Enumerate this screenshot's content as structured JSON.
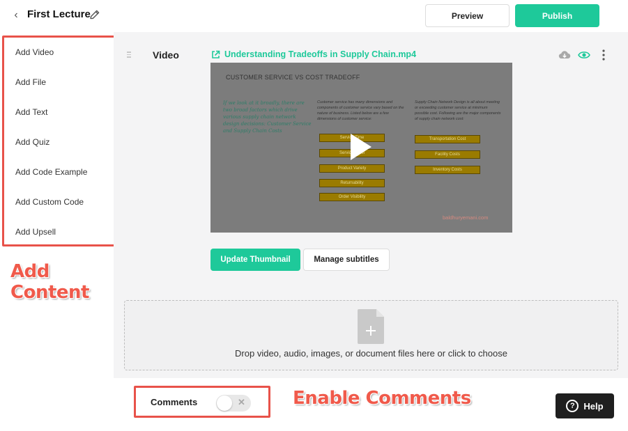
{
  "header": {
    "title": "First Lecture",
    "preview_label": "Preview",
    "publish_label": "Publish"
  },
  "sidebar": {
    "items": [
      {
        "label": "Add Video"
      },
      {
        "label": "Add File"
      },
      {
        "label": "Add Text"
      },
      {
        "label": "Add Quiz"
      },
      {
        "label": "Add Code Example"
      },
      {
        "label": "Add Custom Code"
      },
      {
        "label": "Add Upsell"
      }
    ]
  },
  "annotations": {
    "add_content": "Add Content",
    "enable_comments": "Enable Comments"
  },
  "lesson": {
    "section_label": "Video",
    "file_name": "Understanding Tradeoffs in Supply Chain.mp4",
    "update_thumbnail_label": "Update Thumbnail",
    "manage_subtitles_label": "Manage subtitles"
  },
  "video_slide": {
    "title": "CUSTOMER SERVICE VS COST TRADEOFF",
    "col1": "If we look at it broadly, there are two broad factors which drive various supply chain network design decisions: Customer Service and Supply Chain Costs",
    "col2": "Customer service has many dimensions and components of customer service vary based on the nature of business. Listed below are a few dimensions of customer service:",
    "col3": "Supply Chain Network Design is all about meeting or exceeding customer service at minimum possible cost. Following are the major components of supply chain network cost:",
    "service_boxes": [
      "Service Time",
      "Service Level",
      "Product Variety",
      "Returnability",
      "Order Visibility"
    ],
    "cost_boxes": [
      "Transportation Cost",
      "Facility Costs",
      "Inventory Costs"
    ],
    "footer": "baldhuryemani.com"
  },
  "dropzone": {
    "text": "Drop video, audio, images, or document files here or click to choose"
  },
  "comments": {
    "label": "Comments",
    "enabled": false
  },
  "help": {
    "label": "Help"
  },
  "colors": {
    "accent": "#1ec99a",
    "annotation": "#e8524a"
  }
}
